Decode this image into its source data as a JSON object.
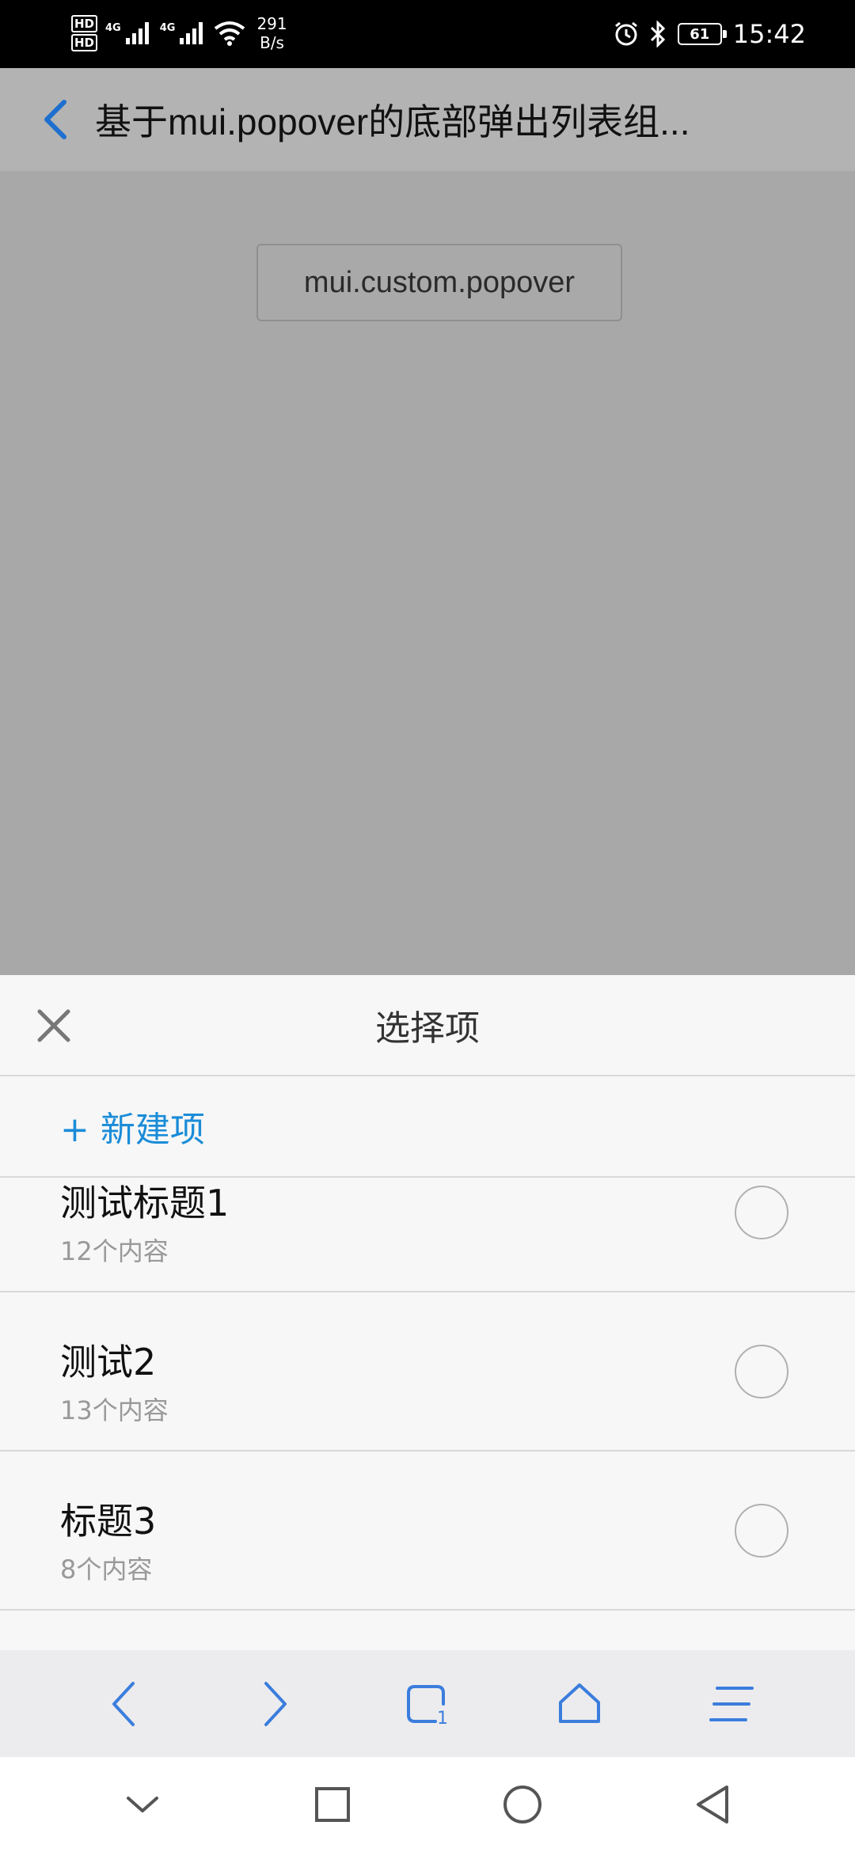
{
  "status_bar": {
    "hd1": "HD",
    "hd2": "HD",
    "net_type1": "4G",
    "net_type2": "4G",
    "speed_value": "291",
    "speed_unit": "B/s",
    "battery": "61",
    "time": "15:42"
  },
  "header": {
    "title": "基于mui.popover的底部弹出列表组..."
  },
  "content": {
    "popover_button_label": "mui.custom.popover"
  },
  "sheet": {
    "title": "选择项",
    "new_item_label": "+ 新建项",
    "items": [
      {
        "title": "测试标题1",
        "subtitle": "12个内容"
      },
      {
        "title": "测试2",
        "subtitle": "13个内容"
      },
      {
        "title": "标题3",
        "subtitle": "8个内容"
      }
    ]
  },
  "browser_toolbar": {
    "tab_count": "1"
  },
  "colors": {
    "accent_blue": "#1a8cd8",
    "toolbar_icon_blue": "#3b7ddd"
  },
  "icons": {
    "back": "chevron-left-icon",
    "close": "close-icon",
    "forward": "chevron-right-icon",
    "tabs": "tabs-icon",
    "home": "home-icon",
    "menu": "menu-icon"
  }
}
